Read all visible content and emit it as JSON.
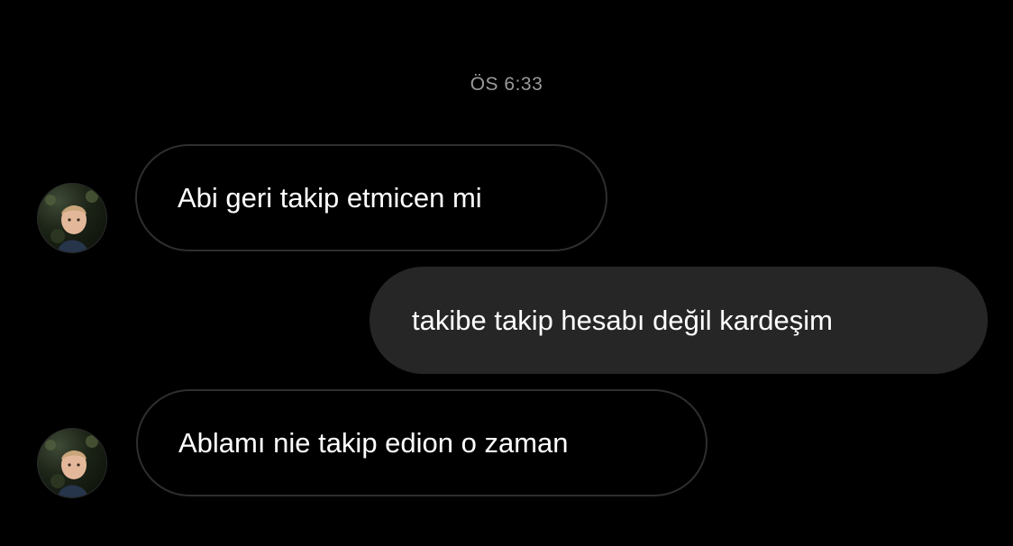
{
  "chat": {
    "timestamp": "ÖS 6:33",
    "messages": [
      {
        "sender": "other",
        "text": "Abi geri takip etmicen mi",
        "avatar": "profile-photo"
      },
      {
        "sender": "me",
        "text": "takibe takip hesabı değil kardeşim"
      },
      {
        "sender": "other",
        "text": "Ablamı nie takip edion o zaman",
        "avatar": "profile-photo"
      }
    ]
  },
  "colors": {
    "background": "#000000",
    "incoming_border": "#2e2e2e",
    "outgoing_bubble": "#262626",
    "text": "#ffffff",
    "timestamp": "#9a9a9a"
  }
}
